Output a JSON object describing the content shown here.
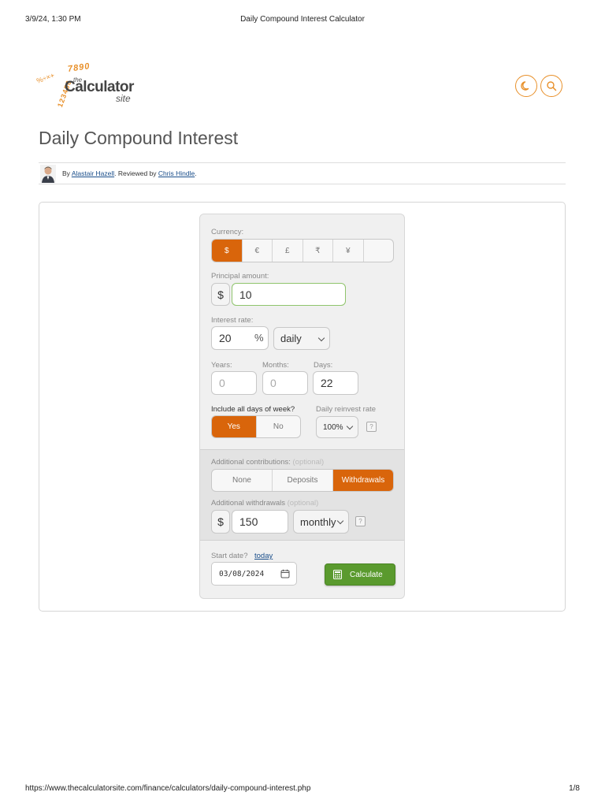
{
  "print_header": {
    "datetime": "3/9/24, 1:30 PM",
    "title": "Daily Compound Interest Calculator"
  },
  "print_footer": {
    "url": "https://www.thecalculatorsite.com/finance/calculators/daily-compound-interest.php",
    "page": "1/8"
  },
  "logo": {
    "digits_top": "7890",
    "digits_side": "123456",
    "symbols": "%÷×+",
    "the": "the",
    "name": "Calculator",
    "site": "site"
  },
  "header_icons": [
    "moon-icon",
    "search-icon"
  ],
  "page": {
    "title": "Daily Compound Interest"
  },
  "byline": {
    "prefix": "By",
    "author": "Alastair Hazell",
    "middle": ". Reviewed by",
    "reviewer": "Chris Hindle",
    "suffix": "."
  },
  "form": {
    "currency": {
      "label": "Currency:",
      "options": [
        "$",
        "€",
        "£",
        "₹",
        "¥",
        ""
      ],
      "selected": "$"
    },
    "principal": {
      "label": "Principal amount:",
      "symbol": "$",
      "value": "10"
    },
    "interest": {
      "label": "Interest rate:",
      "value": "20",
      "unit": "%",
      "frequency": "daily"
    },
    "term": {
      "years_label": "Years:",
      "years_placeholder": "0",
      "months_label": "Months:",
      "months_placeholder": "0",
      "days_label": "Days:",
      "days_value": "22"
    },
    "all_days": {
      "label": "Include all days of week?",
      "yes": "Yes",
      "no": "No",
      "selected": "Yes"
    },
    "reinvest": {
      "label": "Daily reinvest rate",
      "value": "100%",
      "help": "?"
    },
    "contributions": {
      "label": "Additional contributions:",
      "optional": "(optional)",
      "options": [
        "None",
        "Deposits",
        "Withdrawals"
      ],
      "selected": "Withdrawals"
    },
    "withdrawals": {
      "label": "Additional withdrawals",
      "optional": "(optional)",
      "symbol": "$",
      "value": "150",
      "frequency": "monthly",
      "help": "?"
    },
    "start_date": {
      "label": "Start date?",
      "today_link": "today",
      "value": "03/08/2024"
    },
    "calculate_label": "Calculate"
  },
  "colors": {
    "accent": "#d9650b",
    "logo_orange": "#e8902a",
    "calculate_green": "#5a9a2e",
    "link": "#1a4e8a"
  }
}
